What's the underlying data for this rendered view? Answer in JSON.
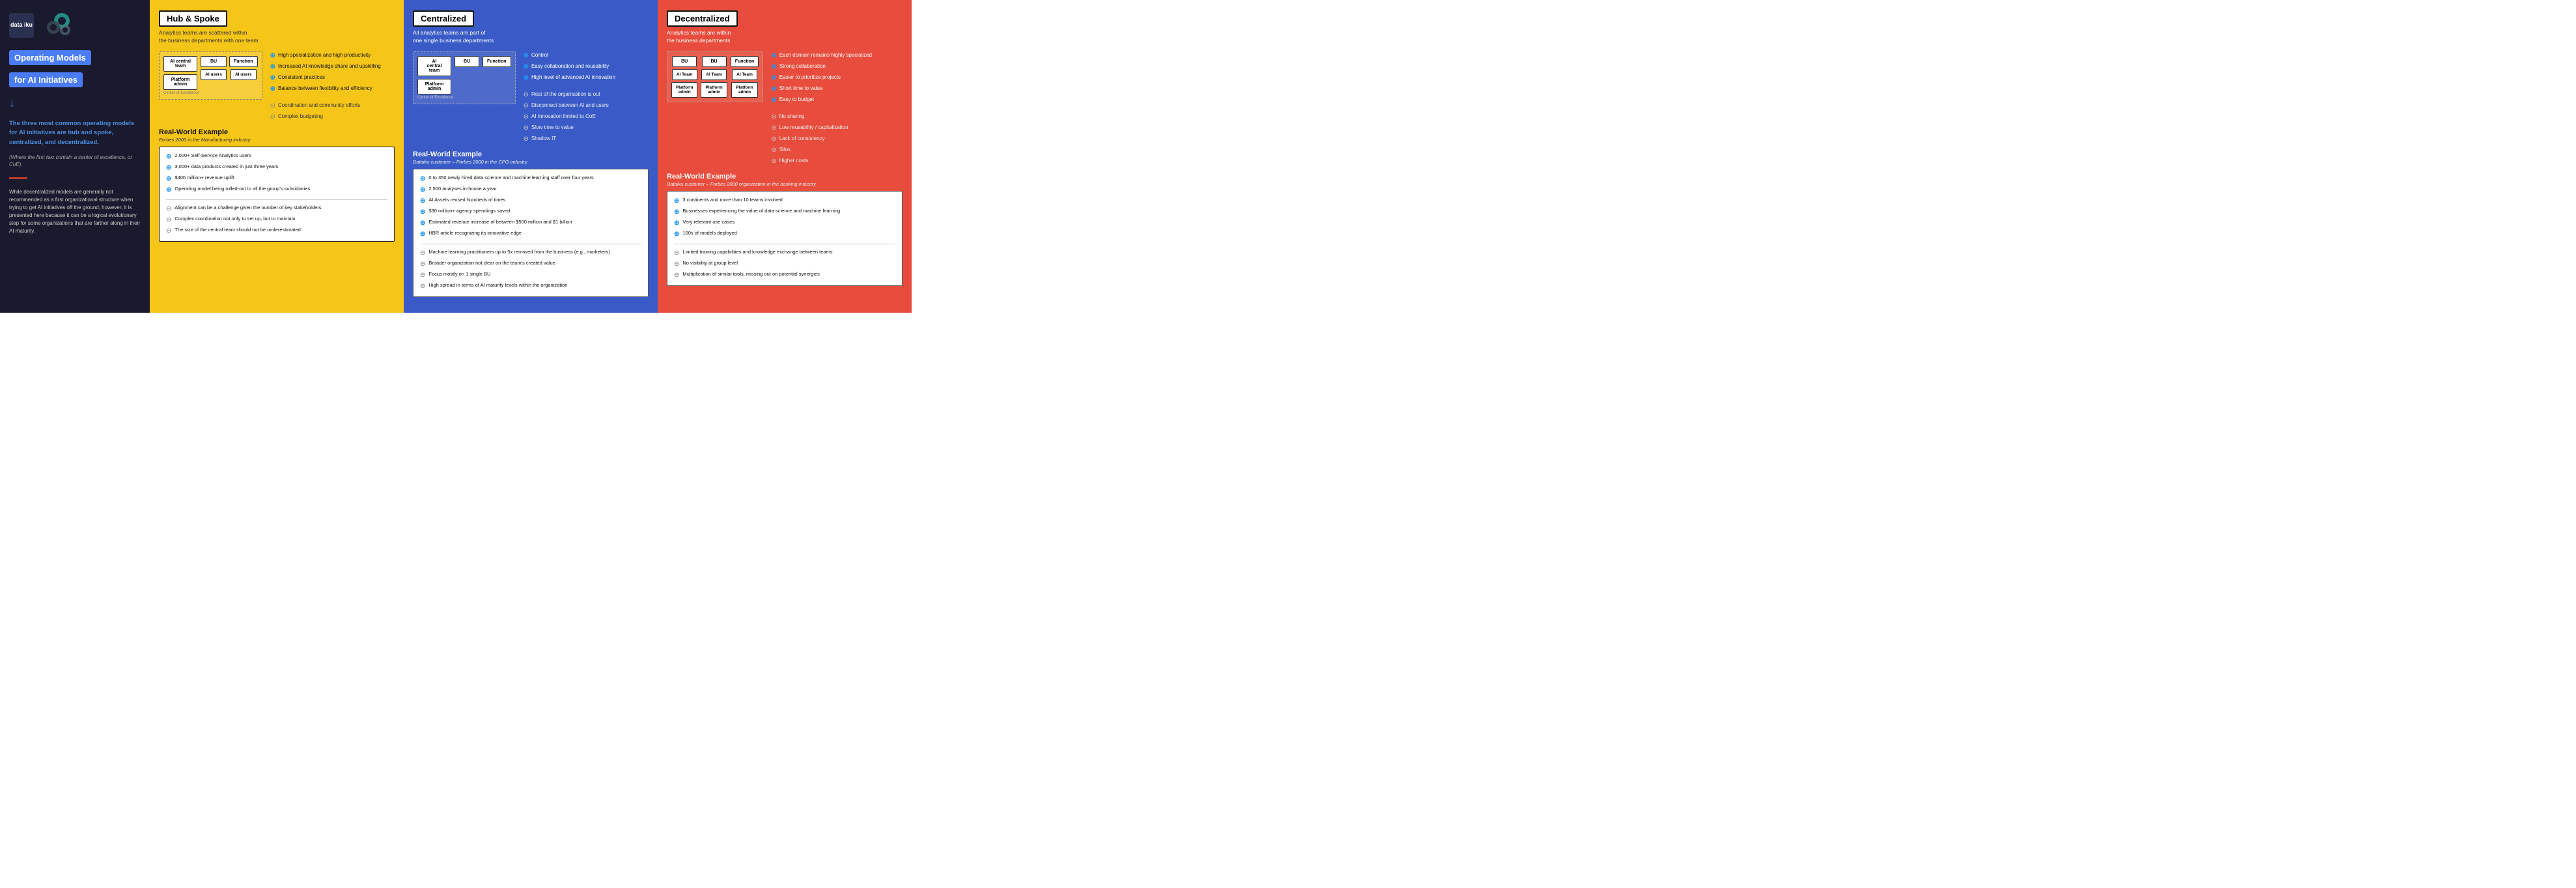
{
  "left": {
    "logo": "data\niku",
    "title_line1": "Operating Models",
    "title_line2": "for AI Initiatives",
    "arrow": "↓",
    "intro": "The three most common operating models for AI initiatives are hub and spoke, centralized, and decentralized.",
    "note": "(Where the first two contain a center of excellence, or CoE).",
    "body": "While decentralized models are generally not recommended as a first organizational structure when trying to get AI initiatives off the ground; however, it is presented here because it can be a logical evolutionary step for some organizations that are farther along in their AI maturity."
  },
  "hub": {
    "title": "Hub & Spoke",
    "subtitle_line1": "Analytics teams are scattered within",
    "subtitle_line2": "the business departments with one team",
    "diagram": {
      "central": "AI central\nteam",
      "platform": "Platform\nadmin",
      "bu": "BU",
      "function": "Function",
      "ai_users_1": "AI users",
      "ai_users_2": "AI users",
      "coe": "Center of Excellence"
    },
    "pros": [
      "High specialization and high productivity",
      "Increased AI knowledge share and upskilling",
      "Consistent practices",
      "Balance between flexibility and efficiency"
    ],
    "cons": [
      "Coordination and community efforts",
      "Complex budgeting"
    ],
    "rwe_title": "Real-World Example",
    "rwe_subtitle": "Forbes 2000 in the Manufacturing industry",
    "rwe_pros": [
      "2,000+ Self-Service Analytics users",
      "3,000+ data products created in just three years",
      "$400 million+ revenue uplift",
      "Operating model being rolled-out to all the group's subsidiaries"
    ],
    "rwe_cons": [
      "Alignment can be a challenge given the number of key stakeholders",
      "Complex coordination not only to set up, but to maintain",
      "The size of the central team should not be underestimated"
    ]
  },
  "centralized": {
    "title": "Centralized",
    "subtitle_line1": "All analytics teams are part of",
    "subtitle_line2": "one single business departments",
    "diagram": {
      "central": "AI\ncentral\nteam",
      "platform": "Platform\nadmin",
      "bu": "BU",
      "function": "Function",
      "coe": "Center of Excellence"
    },
    "pros": [
      "Control",
      "Easy collaboration and reusability",
      "High level of advanced AI innovation"
    ],
    "cons": [
      "Rest of the organisation is out",
      "Disconnect between AI and users",
      "AI Innovation limited to CoE",
      "Slow time to value",
      "Shadow IT"
    ],
    "rwe_title": "Real-World Example",
    "rwe_subtitle": "Dataiku customer – Forbes 2000 in the CPG industry",
    "rwe_pros": [
      "0 to 350 newly hired data science and machine learning staff over four years",
      "2,500 analyses in-house a year",
      "AI Assets reused hundreds of times",
      "$30 million+ agency spendings saved",
      "Estimated revenue increase of between $500 million and $1 billion",
      "HBR article recognizing its innovative edge"
    ],
    "rwe_cons": [
      "Machine learning practitioners up to 5x removed from the business (e.g., marketers)",
      "Broader organization not clear on the team's created value",
      "Focus mostly on 1 single BU",
      "High spread in terms of AI maturity levels within the organization"
    ]
  },
  "decentralized": {
    "title": "Decentralized",
    "subtitle_line1": "Analytics teams are within",
    "subtitle_line2": "the business departments",
    "diagram": {
      "bu1": "BU",
      "bu2": "BU",
      "function": "Function",
      "ai_team_1": "AI Team",
      "ai_team_2": "AI Team",
      "ai_team_3": "AI Team",
      "platform_1": "Platform\nadmin",
      "platform_2": "Platform\nadmin",
      "platform_3": "Platform\nadmin"
    },
    "pros": [
      "Each domain remains highly specialized",
      "Strong collaboration",
      "Easier to prioritize projects",
      "Short time to value",
      "Easy to budget"
    ],
    "cons": [
      "No sharing",
      "Low reusability / capitalization",
      "Lack of consistency",
      "Silos",
      "Higher costs"
    ],
    "rwe_title": "Real-World Example",
    "rwe_subtitle": "Dataiku customer – Forbes 2000 organization in the banking industry",
    "rwe_pros": [
      "3 continents and more than 10 teams involved",
      "Businesses experiencing the value of data science and machine learning",
      "Very relevant use cases",
      "100s of models deployed"
    ],
    "rwe_cons": [
      "Limited training capabilities and knowledge exchange between teams",
      "No visibility at group level",
      "Multiplication of similar tools, missing out on potential synergies"
    ]
  },
  "icons": {
    "plus": "⊕",
    "minus": "⊖"
  }
}
